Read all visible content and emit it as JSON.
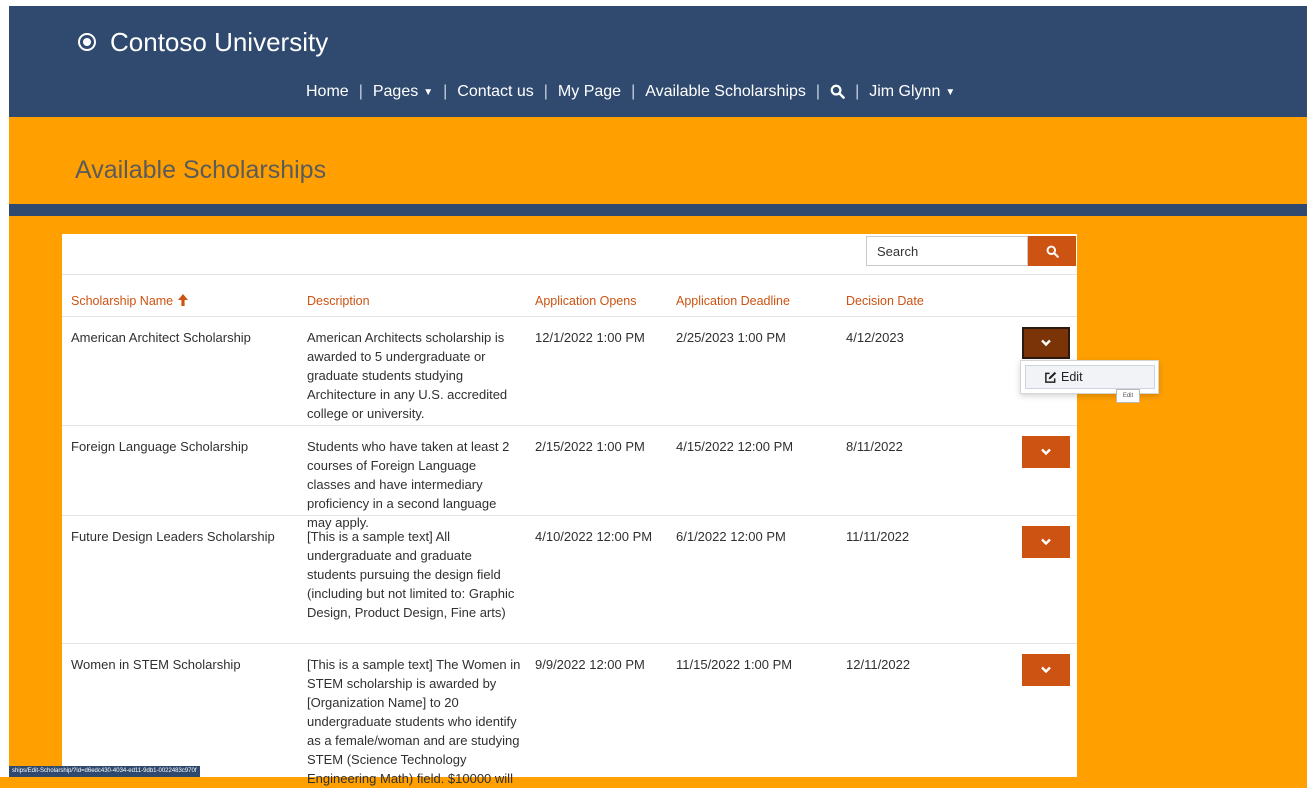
{
  "brand": {
    "name": "Contoso University"
  },
  "nav": {
    "home": "Home",
    "pages": "Pages",
    "contact": "Contact us",
    "mypage": "My Page",
    "scholarships": "Available Scholarships",
    "user": "Jim Glynn",
    "separator": "|"
  },
  "page": {
    "title": "Available Scholarships"
  },
  "search": {
    "value": "Search"
  },
  "table": {
    "headers": {
      "name": "Scholarship Name",
      "description": "Description",
      "opens": "Application Opens",
      "deadline": "Application Deadline",
      "decision": "Decision Date"
    },
    "rows": [
      {
        "name": "American Architect Scholarship",
        "description": "American Architects scholarship is awarded to 5 undergraduate or graduate students studying Architecture in any U.S. accredited college or university.",
        "opens": "12/1/2022 1:00 PM",
        "deadline": "2/25/2023 1:00 PM",
        "decision": "4/12/2023"
      },
      {
        "name": "Foreign Language Scholarship",
        "description": "Students who have taken at least 2 courses of Foreign Language classes and have intermediary proficiency in a second language may apply.",
        "opens": "2/15/2022 1:00 PM",
        "deadline": "4/15/2022 12:00 PM",
        "decision": "8/11/2022"
      },
      {
        "name": "Future Design Leaders Scholarship",
        "description": "[This is a sample text] All undergraduate and graduate students pursuing the design field (including but not limited to: Graphic Design, Product Design, Fine arts)",
        "opens": "4/10/2022 12:00 PM",
        "deadline": "6/1/2022 12:00 PM",
        "decision": "11/11/2022"
      },
      {
        "name": "Women in STEM Scholarship",
        "description": "[This is a sample text] The Women in STEM scholarship is awarded by [Organization Name] to 20 undergraduate students who identify as a female/woman and are studying STEM (Science Technology Engineering Math) field. $10000 will",
        "opens": "9/9/2022 12:00 PM",
        "deadline": "11/15/2022 1:00 PM",
        "decision": "12/11/2022"
      }
    ]
  },
  "dropdown": {
    "edit": "Edit",
    "tooltip": "Edit"
  },
  "status_url": "ships/Edit-Scholarship/?id=d6edc430-4034-ed11-9db1-0022483c970f",
  "colors": {
    "header_bg": "#2f4a6e",
    "accent_orange": "#ffa000",
    "button_orange": "#cc5312",
    "button_active": "#7a3408"
  }
}
